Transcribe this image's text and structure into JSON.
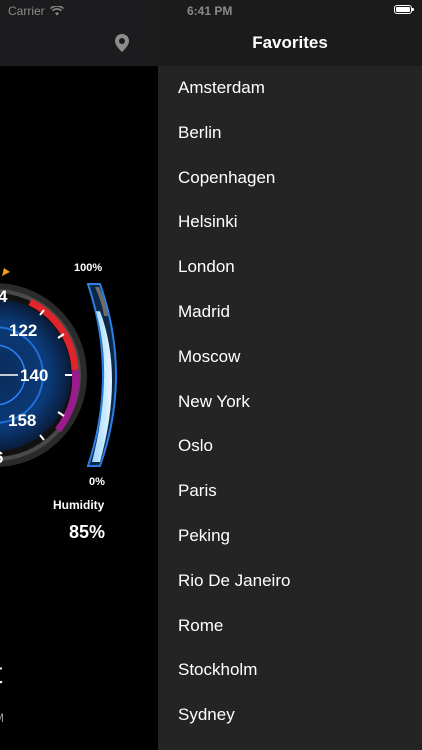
{
  "status_bar": {
    "carrier": "Carrier",
    "time": "6:41 PM"
  },
  "main": {
    "header": {
      "location_icon": "location-pin-icon"
    },
    "gauge": {
      "tick_labels": [
        "4",
        "122",
        "140",
        "158",
        "6"
      ]
    },
    "humidity": {
      "label": "Humidity",
      "value": "85%",
      "scale_top": "100%",
      "scale_bottom": "0%",
      "level": 0.85
    },
    "city_fragment": "t",
    "subtitle_fragment": "M"
  },
  "favorites": {
    "title": "Favorites",
    "items": [
      "Amsterdam",
      "Berlin",
      "Copenhagen",
      "Helsinki",
      "London",
      "Madrid",
      "Moscow",
      "New York",
      "Oslo",
      "Paris",
      "Peking",
      "Rio De Janeiro",
      "Rome",
      "Stockholm",
      "Sydney"
    ]
  },
  "colors": {
    "drawer_bg": "#242424",
    "drawer_header_bg": "#1b1b1b",
    "gauge_blue": "#1f6fd1",
    "gauge_red": "#e0242b",
    "gauge_purple": "#9b1a8f"
  }
}
